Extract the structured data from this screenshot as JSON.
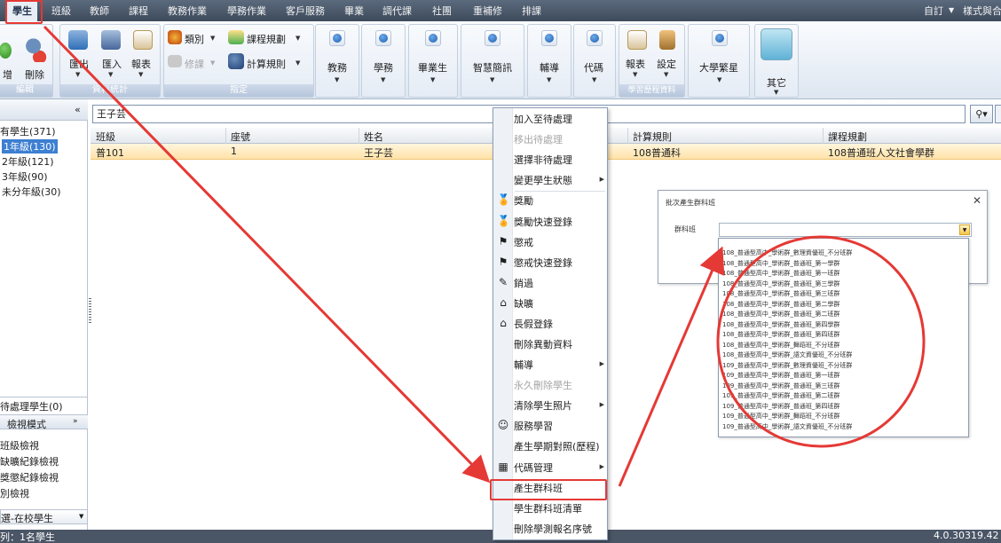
{
  "menubar": {
    "items": [
      "學生",
      "班級",
      "教師",
      "課程",
      "教務作業",
      "學務作業",
      "客戶服務",
      "畢業",
      "調代課",
      "社團",
      "重補修",
      "排課"
    ],
    "right_items": [
      "自訂",
      "樣式與合"
    ]
  },
  "ribbon": {
    "edit_group": {
      "delete_label": "刪除",
      "cut_label": "增",
      "group_label": "編輯"
    },
    "data_group": {
      "export_label": "匯出",
      "import_label": "匯入",
      "report_label": "報表",
      "group_label": "資料統計"
    },
    "assign_group": {
      "category_label": "類別",
      "repair_label": "修課",
      "course_rule_label": "課程規劃",
      "calc_rule_label": "計算規則",
      "group_label": "指定"
    },
    "buttons": [
      "教務",
      "學務",
      "畢業生",
      "智慧簡訊",
      "輔導",
      "代碼"
    ],
    "history_group": {
      "report_label": "報表",
      "settings_label": "設定",
      "group_label": "學習歷程資料"
    },
    "university_label": "大學繁星",
    "other_label": "其它"
  },
  "left_panel": {
    "tree": [
      "有學生(371)",
      "1年級(130)",
      "2年級(121)",
      "3年級(90)",
      "未分年級(30)"
    ],
    "pending": "待處理學生(0)",
    "view_mode": "檢視模式",
    "views": [
      "班級檢視",
      "缺曠紀錄檢視",
      "獎懲紀錄檢視",
      "別檢視"
    ],
    "filter": "選-在校學生"
  },
  "search": {
    "value": "王子芸"
  },
  "grid": {
    "columns": [
      "班級",
      "座號",
      "姓名",
      "計算規則",
      "課程規劃"
    ],
    "row": [
      "普101",
      "1",
      "王子芸",
      "108普通科",
      "108普通班人文社會學群"
    ]
  },
  "status": {
    "left": "列：1名學生",
    "version": "4.0.30319.42"
  },
  "context_menu": {
    "items": [
      {
        "label": "加入至待處理",
        "disabled": false
      },
      {
        "label": "移出待處理",
        "disabled": true
      },
      {
        "label": "選擇非待處理",
        "disabled": false
      },
      {
        "label": "變更學生狀態",
        "disabled": false,
        "submenu": true
      },
      {
        "label": "獎勵",
        "disabled": false,
        "icon": "medal-icon"
      },
      {
        "label": "獎勵快速登錄",
        "disabled": false,
        "icon": "medal-icon"
      },
      {
        "label": "懲戒",
        "disabled": false,
        "icon": "penalty-icon"
      },
      {
        "label": "懲戒快速登錄",
        "disabled": false,
        "icon": "penalty-icon"
      },
      {
        "label": "銷過",
        "disabled": false,
        "icon": "pen-icon"
      },
      {
        "label": "缺曠",
        "disabled": false,
        "icon": "attendance-icon"
      },
      {
        "label": "長假登錄",
        "disabled": false,
        "icon": "attendance-icon"
      },
      {
        "label": "刪除異動資料",
        "disabled": false
      },
      {
        "label": "輔導",
        "disabled": false,
        "submenu": true
      },
      {
        "label": "永久刪除學生",
        "disabled": true
      },
      {
        "label": "清除學生照片",
        "disabled": false,
        "submenu": true
      },
      {
        "label": "服務學習",
        "disabled": false,
        "icon": "service-icon"
      },
      {
        "label": "產生學期對照(歷程)",
        "disabled": false
      },
      {
        "label": "代碼管理",
        "disabled": false,
        "submenu": true,
        "icon": "code-icon"
      },
      {
        "label": "產生群科班",
        "disabled": false
      },
      {
        "label": "學生群科班清單",
        "disabled": false
      },
      {
        "label": "刪除學測報名序號",
        "disabled": false
      }
    ]
  },
  "dialog": {
    "title": "批次產生群科班",
    "field_label": "群科班",
    "options": [
      "108_普通型高中_學術群_數理資優班_不分班群",
      "108_普通型高中_學術群_普通班_第一學群",
      "108_普通型高中_學術群_普通班_第一班群",
      "108_普通型高中_學術群_普通班_第三學群",
      "108_普通型高中_學術群_普通班_第三班群",
      "108_普通型高中_學術群_普通班_第二學群",
      "108_普通型高中_學術群_普通班_第二班群",
      "108_普通型高中_學術群_普通班_第四學群",
      "108_普通型高中_學術群_普通班_第四班群",
      "108_普通型高中_學術群_舞蹈班_不分班群",
      "108_普通型高中_學術群_語文資優班_不分班群",
      "109_普通型高中_學術群_數理資優班_不分班群",
      "109_普通型高中_學術群_普通班_第一班群",
      "109_普通型高中_學術群_普通班_第三班群",
      "109_普通型高中_學術群_普通班_第二班群",
      "109_普通型高中_學術群_普通班_第四班群",
      "109_普通型高中_學術群_舞蹈班_不分班群",
      "109_普通型高中_學術群_語文資優班_不分班群"
    ]
  },
  "colors": {
    "annotation_red": "#e53935",
    "selection_blue": "#3d7fd1",
    "menubar": "#4a5566"
  }
}
